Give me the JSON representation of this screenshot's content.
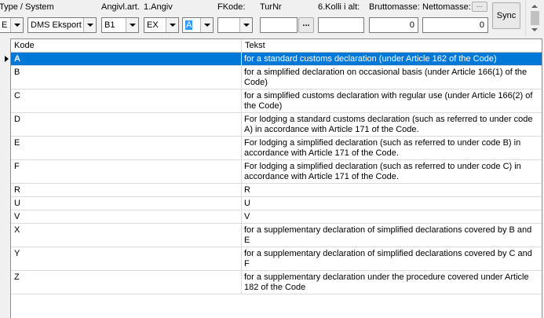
{
  "toolbar": {
    "labels": {
      "type_system": "Type / System",
      "angivl_art": "Angivl.art.",
      "forste_angiv": "1.Angiv",
      "fkode": "FKode:",
      "turnr": "TurNr",
      "kolli": "6.Kolli i alt:",
      "brutto": "Bruttomasse:",
      "netto": "Nettomasse:"
    },
    "fields": {
      "type": "E",
      "system": "DMS Eksport",
      "angivl_art": "B1",
      "forste_angiv": "EX",
      "code": "A",
      "fkode": "",
      "turnr": "",
      "kolli": "",
      "brutto": "0",
      "netto": "0"
    },
    "buttons": {
      "turnr_lookup": "...",
      "netto_lookup": "...",
      "sync": "Sync"
    }
  },
  "grid": {
    "columns": [
      "Kode",
      "Tekst"
    ],
    "selected_index": 0,
    "rows": [
      {
        "kode": "A",
        "tekst": "for a standard customs declaration (under Article 162 of the Code)"
      },
      {
        "kode": "B",
        "tekst": "for a simplified declaration on occasional basis (under Article 166(1) of the Code)"
      },
      {
        "kode": "C",
        "tekst": "for a simplified customs declaration with regular use (under Article 166(2) of the Code)"
      },
      {
        "kode": "D",
        "tekst": "For lodging a standard customs declaration (such as referred to under code A) in accordance with Article 171 of the Code."
      },
      {
        "kode": "E",
        "tekst": "For lodging a simplified declaration (such as referred to under code B) in accordance with Article 171 of the Code."
      },
      {
        "kode": "F",
        "tekst": "For lodging a simplified declaration (such as referred to under code C) in accordance with Article 171 of the Code."
      },
      {
        "kode": "R",
        "tekst": "R"
      },
      {
        "kode": "U",
        "tekst": "U"
      },
      {
        "kode": "V",
        "tekst": "V"
      },
      {
        "kode": "X",
        "tekst": "for a supplementary declaration of simplified declarations covered by B and E"
      },
      {
        "kode": "Y",
        "tekst": "for a supplementary declaration of simplified declarations covered by C and F"
      },
      {
        "kode": "Z",
        "tekst": "for a supplementary declaration under the procedure covered under Article 182 of the Code"
      }
    ]
  }
}
